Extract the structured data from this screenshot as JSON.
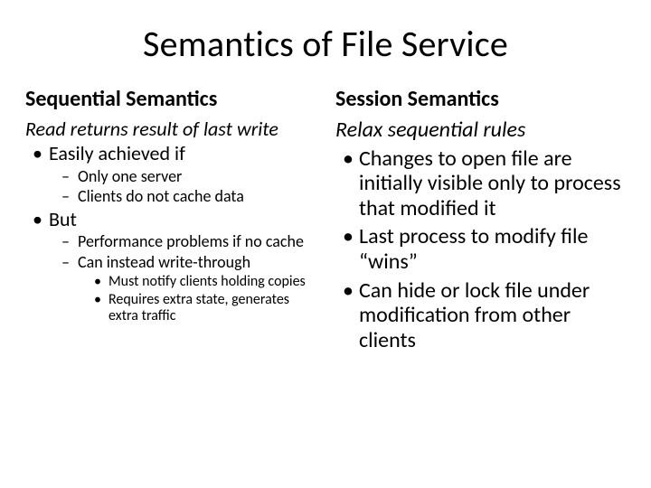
{
  "title": "Semantics of File Service",
  "left": {
    "heading": "Sequential Semantics",
    "intro": "Read returns result of last write",
    "b1": "Easily achieved if",
    "b1a": "Only one server",
    "b1b": "Clients do not cache data",
    "b2": "But",
    "b2a": "Performance problems if no cache",
    "b2b": "Can instead write-through",
    "b2b1": "Must notify clients holding copies",
    "b2b2": "Requires extra state, generates extra traffic"
  },
  "right": {
    "heading": "Session Semantics",
    "intro": "Relax sequential rules",
    "b1": "Changes to open file are initially visible only to process that modified it",
    "b2": "Last process to modify file “wins”",
    "b3": "Can hide or lock file under modification from other clients"
  }
}
